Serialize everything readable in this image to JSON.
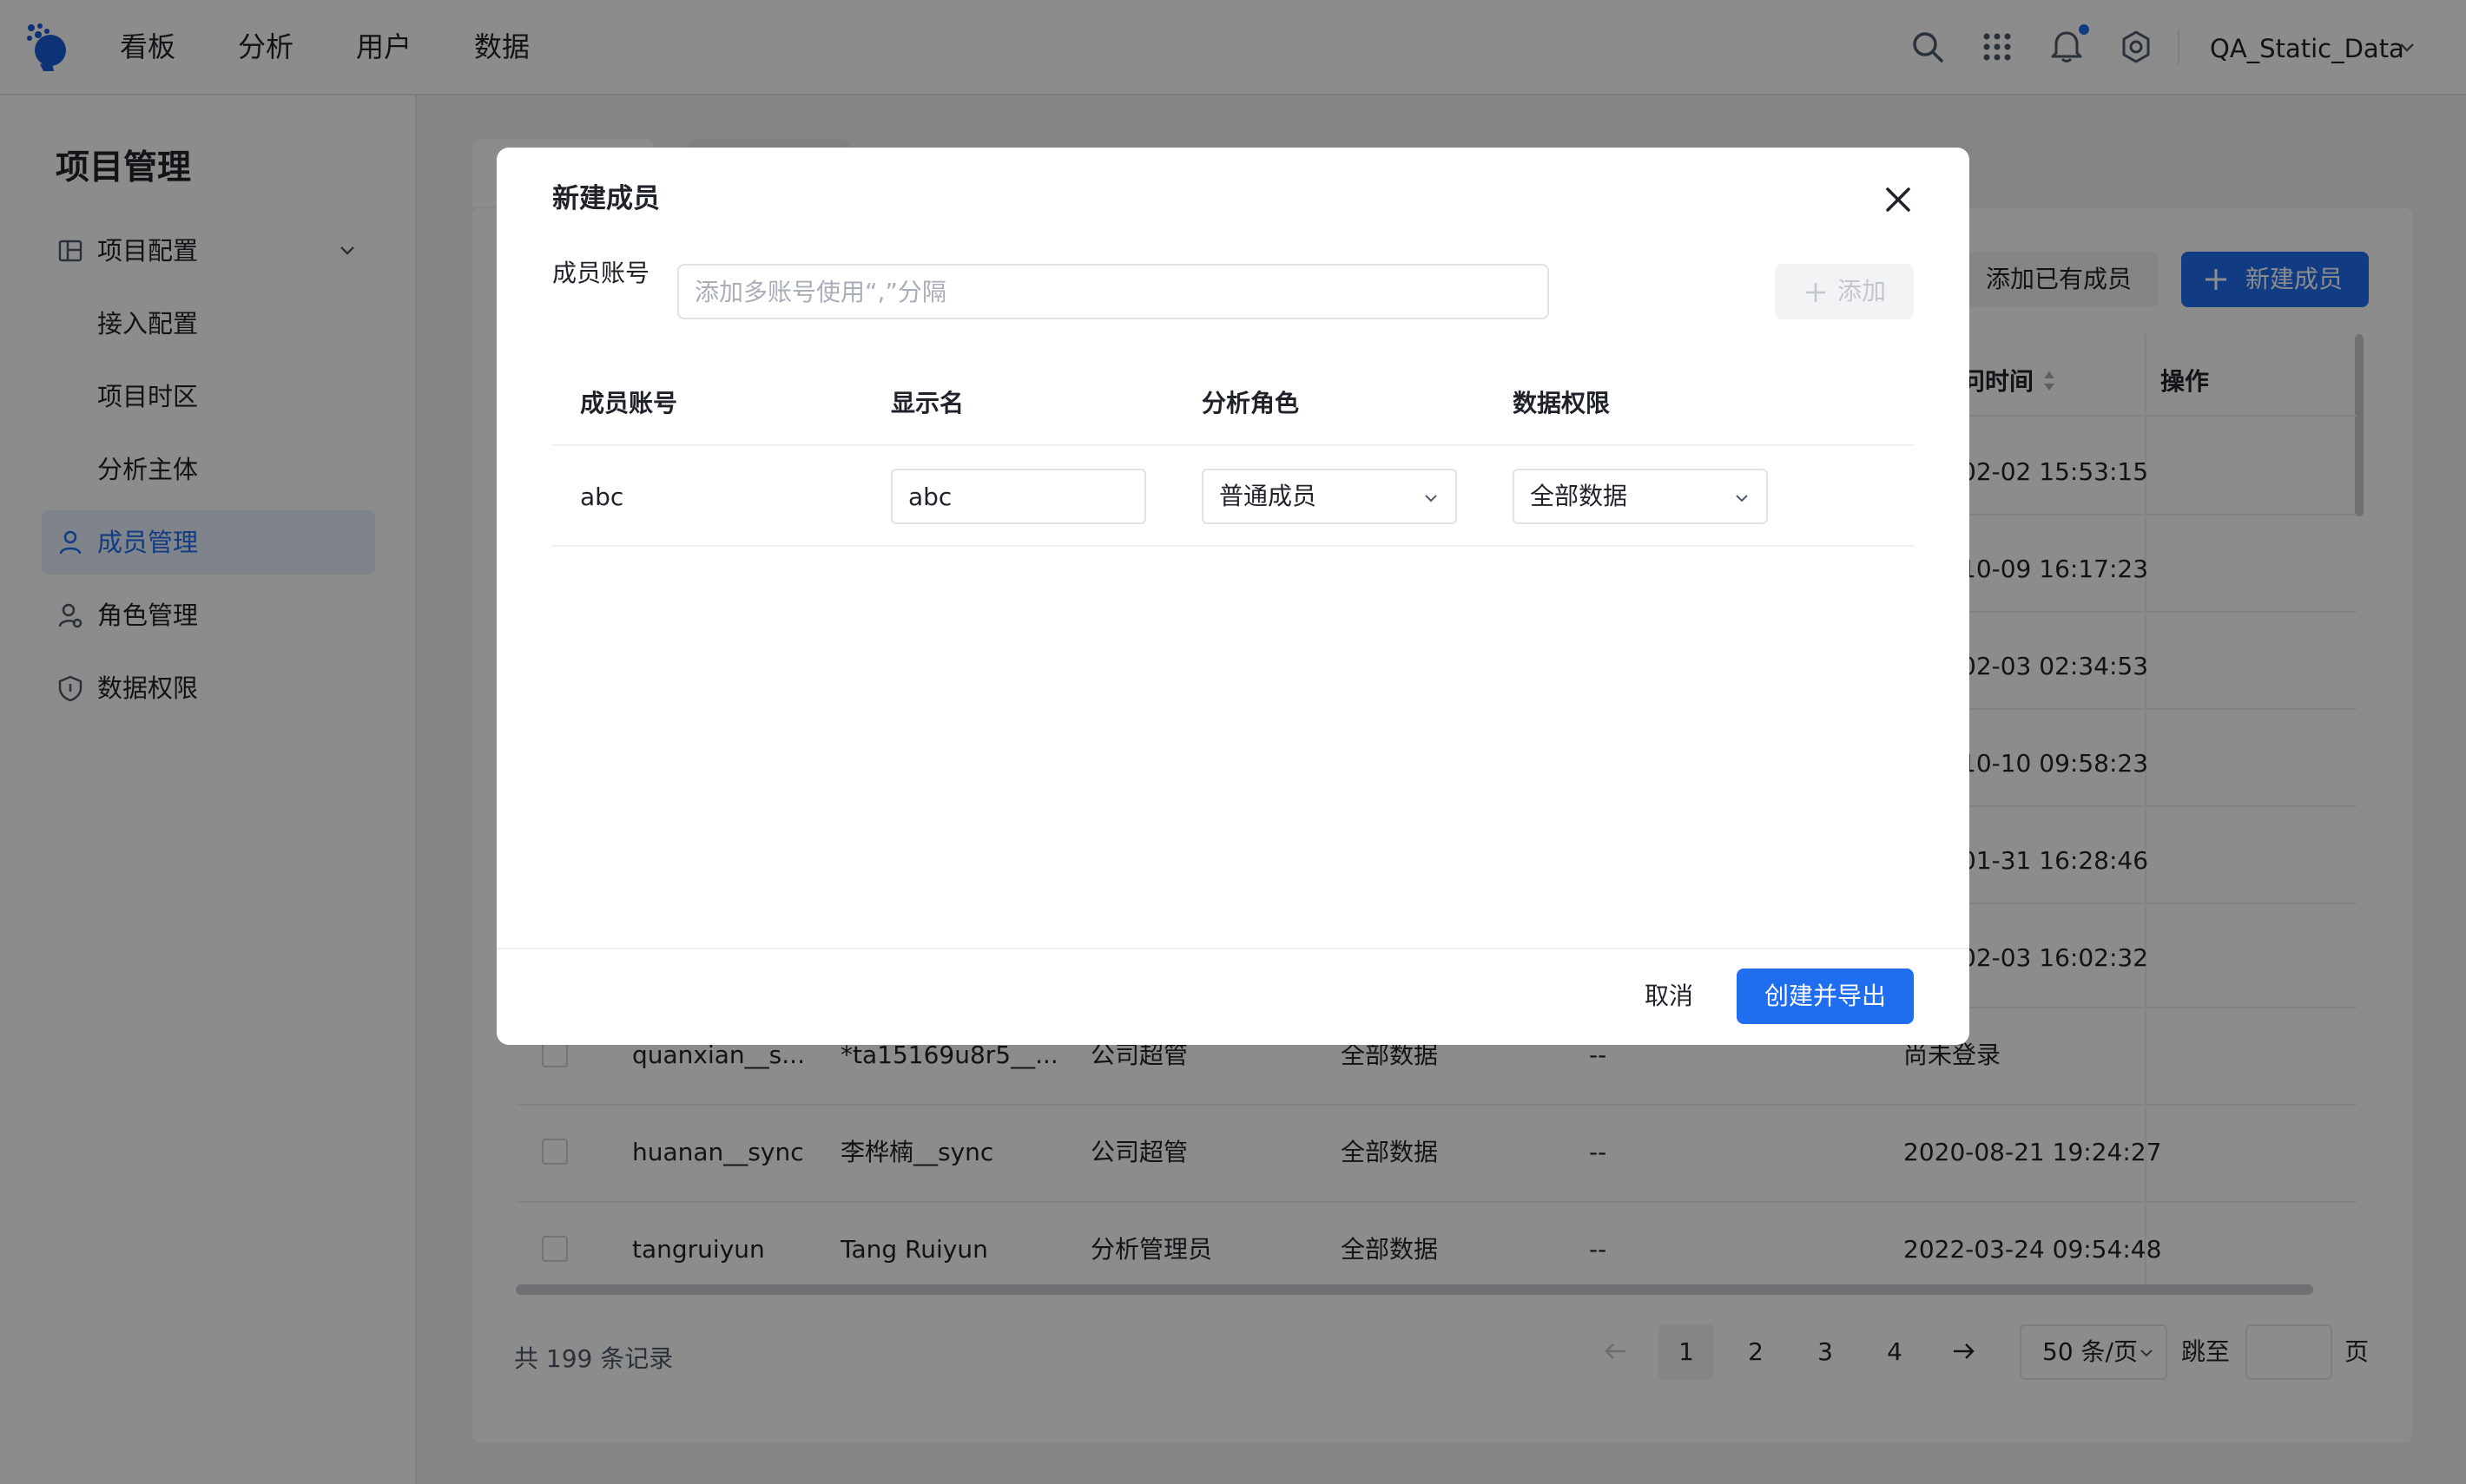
{
  "nav": {
    "items": [
      "看板",
      "分析",
      "用户",
      "数据"
    ],
    "project": "QA_Static_Data",
    "icons": [
      "search-icon",
      "apps-grid-icon",
      "bell-icon",
      "settings-icon"
    ]
  },
  "sidebar": {
    "title": "项目管理",
    "group": "项目配置",
    "subitems": [
      "接入配置",
      "项目时区",
      "分析主体"
    ],
    "items": [
      "成员管理",
      "角色管理",
      "数据权限"
    ]
  },
  "toolbar": {
    "add_existing": "添加已有成员",
    "new_member": "新建成员"
  },
  "table": {
    "headers": {
      "last_visit": "问时间",
      "actions": "操作"
    },
    "visible_times": [
      "02-02 15:53:15",
      "10-09 16:17:23",
      "02-03 02:34:53",
      "10-10 09:58:23",
      "01-31 16:28:46",
      "02-03 16:02:32"
    ],
    "rows": [
      {
        "account": "quanxian__s...",
        "name": "*ta15169u8r5__...",
        "role": "公司超管",
        "data": "全部数据",
        "extra": "--",
        "time": "尚未登录"
      },
      {
        "account": "huanan__sync",
        "name": "李桦楠__sync",
        "role": "公司超管",
        "data": "全部数据",
        "extra": "--",
        "time": "2020-08-21 19:24:27"
      },
      {
        "account": "tangruiyun",
        "name": "Tang Ruiyun",
        "role": "分析管理员",
        "data": "全部数据",
        "extra": "--",
        "time": "2022-03-24 09:54:48"
      }
    ]
  },
  "pagination": {
    "total": "共 199 条记录",
    "pages": [
      "1",
      "2",
      "3",
      "4"
    ],
    "current": "1",
    "page_size": "50 条/页",
    "jump_label": "跳至",
    "page_label": "页"
  },
  "modal": {
    "title": "新建成员",
    "field_label": "成员账号",
    "input_placeholder": "添加多账号使用“,”分隔",
    "add_button": "添加",
    "headers": [
      "成员账号",
      "显示名",
      "分析角色",
      "数据权限"
    ],
    "row": {
      "account": "abc",
      "display_name": "abc",
      "role": "普通成员",
      "data_permission": "全部数据"
    },
    "cancel": "取消",
    "submit": "创建并导出"
  },
  "colors": {
    "primary": "#1f6ef0",
    "mask": "rgba(0,0,0,0.45)"
  }
}
